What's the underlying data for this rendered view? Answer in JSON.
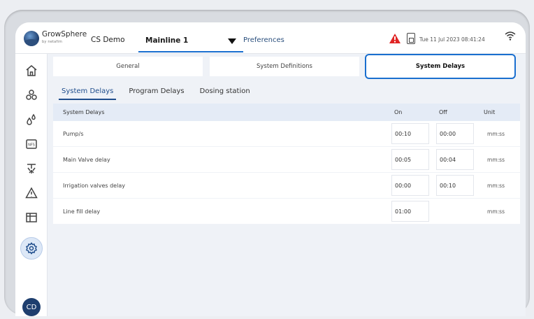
{
  "header": {
    "brand": "GrowSphere",
    "brand_sub": "by netafim",
    "farm_name": "CS Demo",
    "mainline": "Mainline 1",
    "preferences": "Preferences",
    "datetime": "Tue 11 Jul 2023  08:41:24",
    "alert_color": "#e02424"
  },
  "sidebar": {
    "items": [
      {
        "icon": "home-icon"
      },
      {
        "icon": "plants-icon"
      },
      {
        "icon": "water-drops-icon"
      },
      {
        "icon": "nfs-icon",
        "label": "NFS"
      },
      {
        "icon": "irrigation-icon"
      },
      {
        "icon": "warning-icon"
      },
      {
        "icon": "table-icon"
      },
      {
        "icon": "settings-icon"
      }
    ],
    "avatar": "CD"
  },
  "tabs": [
    {
      "label": "General"
    },
    {
      "label": "System Definitions"
    },
    {
      "label": "System Delays",
      "active": true
    }
  ],
  "subtabs": [
    {
      "label": "System Delays",
      "active": true
    },
    {
      "label": "Program Delays"
    },
    {
      "label": "Dosing station"
    }
  ],
  "table": {
    "headers": {
      "name": "System Delays",
      "on": "On",
      "off": "Off",
      "unit": "Unit"
    },
    "rows": [
      {
        "name": "Pump/s",
        "on": "00:10",
        "off": "00:00",
        "unit": "mm:ss"
      },
      {
        "name": "Main Valve delay",
        "on": "00:05",
        "off": "00:04",
        "unit": "mm:ss"
      },
      {
        "name": "Irrigation valves delay",
        "on": "00:00",
        "off": "00:10",
        "unit": "mm:ss"
      },
      {
        "name": "Line fill delay",
        "on": "01:00",
        "off": "",
        "unit": "mm:ss"
      }
    ]
  },
  "colors": {
    "accent": "#1a6fcf",
    "header_row": "#e4ebf6",
    "navy": "#1e3e6e"
  }
}
